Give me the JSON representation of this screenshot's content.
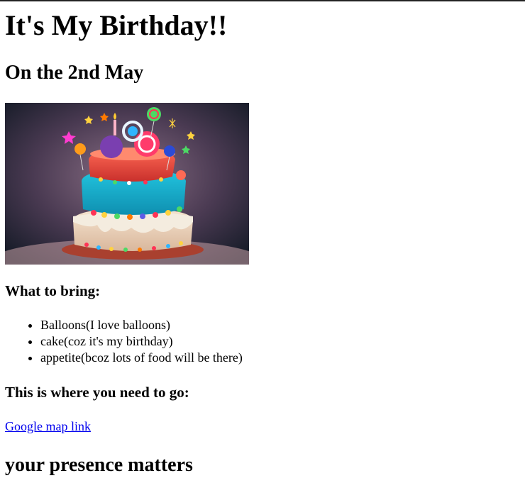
{
  "heading": "It's My Birthday!!",
  "subheading": "On the 2nd May",
  "bring": {
    "title": "What to bring:",
    "items": [
      "Balloons(I love balloons)",
      "cake(coz it's my birthday)",
      "appetite(bcoz lots of food will be there)"
    ]
  },
  "directions": {
    "title": "This is where you need to go:",
    "link_label": "Google map link"
  },
  "closing": "your presence matters",
  "colors": {
    "link": "#0000ee",
    "text": "#000000"
  }
}
